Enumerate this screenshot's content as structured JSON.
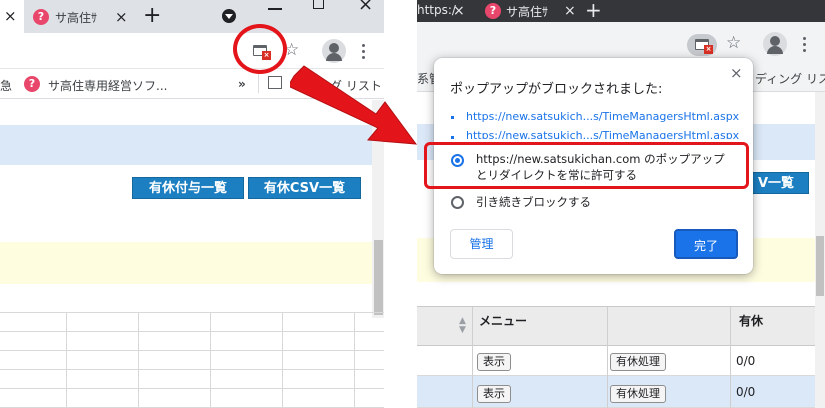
{
  "left": {
    "tabs": [
      {
        "close": "×"
      },
      {
        "title": "サ高住ｻ",
        "close": "×"
      }
    ],
    "newtab": "+",
    "bookmarks": [
      "急",
      "サ高住専用経営ソフ...",
      "»",
      "ング リスト"
    ],
    "buttons": [
      "有休付与一覧",
      "有休CSV一覧"
    ]
  },
  "right": {
    "tabs": [
      {
        "title": "https:/",
        "close": "×"
      },
      {
        "title": "サ高住ｻ",
        "close": "×"
      }
    ],
    "newtab": "+",
    "bookmarks": [
      "系管",
      "ディング リスト"
    ],
    "partial_button": "V一覧",
    "popup": {
      "title": "ポップアップがブロックされました:",
      "links": [
        "https://new.satsukich...s/TimeManagersHtml.aspx",
        "https://new.satsukich...s/TimeManagersHtml.aspx"
      ],
      "option_allow": "https://new.satsukichan.com のポップアップとリダイレクトを常に許可する",
      "option_block": "引き続きブロックする",
      "manage": "管理",
      "done": "完了",
      "close": "×"
    },
    "table": {
      "headers": [
        "メニュー",
        "有休"
      ],
      "rows": [
        {
          "show": "表示",
          "action": "有休処理",
          "value": "0/0"
        },
        {
          "show": "表示",
          "action": "有休処理",
          "value": "0/0"
        }
      ]
    }
  },
  "colors": {
    "accent_red": "#e3151a",
    "link_blue": "#1a73e8",
    "page_button": "#1b7fc1",
    "band_blue": "#dbe8f8",
    "band_yellow": "#fffde0"
  }
}
